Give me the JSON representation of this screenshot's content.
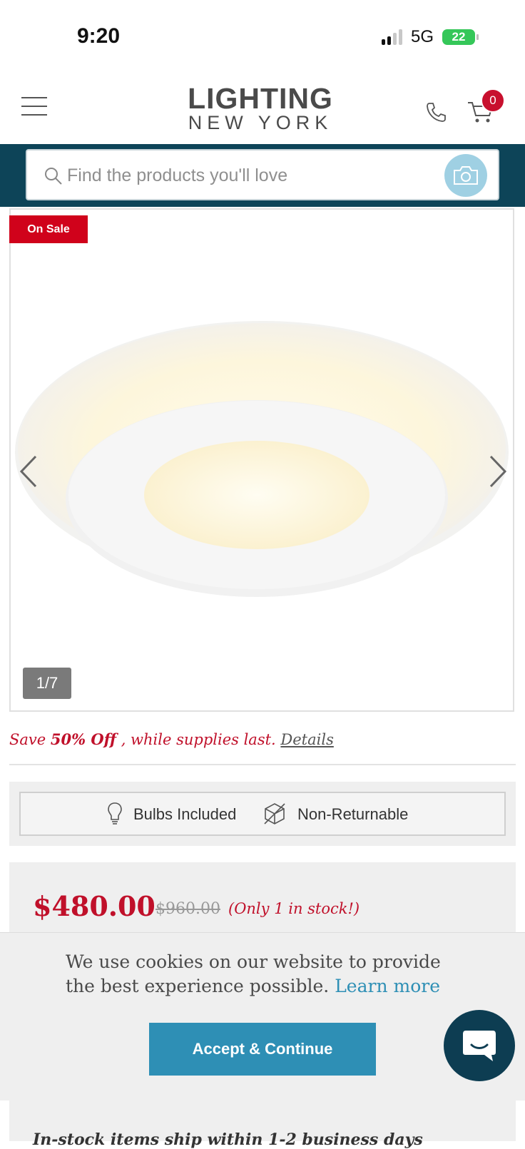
{
  "status_bar": {
    "time": "9:20",
    "network": "5G",
    "battery": "22"
  },
  "header": {
    "logo_main": "LIGHTING",
    "logo_sub": "NEW YORK",
    "cart_count": "0"
  },
  "search": {
    "placeholder": "Find the products you'll love"
  },
  "product_image": {
    "sale_tag": "On Sale",
    "counter": "1/7"
  },
  "promo": {
    "prefix": "Save ",
    "highlight": "50% Off",
    "suffix": " , while supplies last. ",
    "details_link": "Details"
  },
  "features": [
    {
      "label": "Bulbs Included",
      "icon": "bulb-icon"
    },
    {
      "label": "Non-Returnable",
      "icon": "box-icon"
    }
  ],
  "pricing": {
    "price": "$480.00",
    "old_price": "$960.00",
    "stock_note": "(Only 1 in stock!)"
  },
  "shipping": {
    "text": "In-stock items ship within 1-2 business days"
  },
  "cookie_banner": {
    "message": "We use cookies on our website to provide the best experience possible. ",
    "learn_more": "Learn more",
    "accept_label": "Accept & Continue"
  },
  "colors": {
    "brand_teal": "#0d4458",
    "sale_red": "#d0021b",
    "price_red": "#c0102a",
    "accent_blue": "#2e8fb5"
  }
}
